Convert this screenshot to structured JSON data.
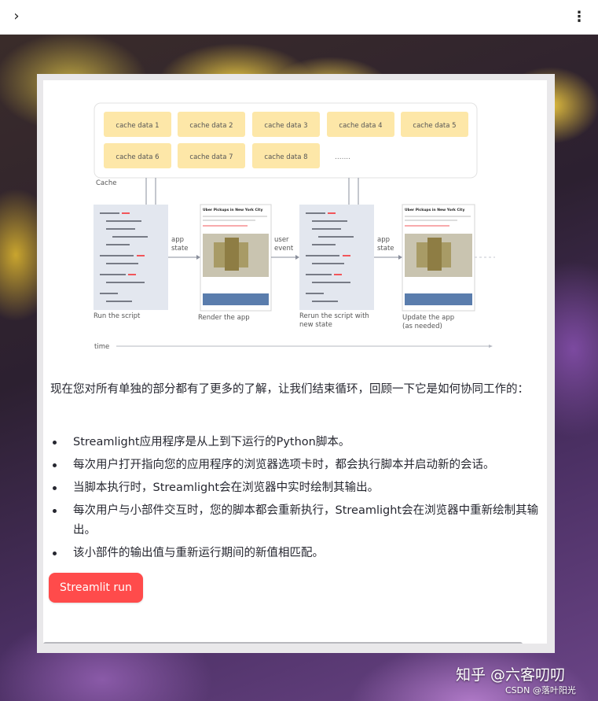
{
  "toolbar": {
    "expand_icon": "chevron-right-icon",
    "menu_icon": "kebab-menu-icon"
  },
  "diagram": {
    "cache_title": "Cache",
    "cache_items": [
      "cache data 1",
      "cache data 2",
      "cache data 3",
      "cache data 4",
      "cache data 5",
      "cache data 6",
      "cache data 7",
      "cache data 8",
      "......."
    ],
    "stages": {
      "run_script": "Run the script",
      "render_app": "Render the app",
      "rerun_line1": "Rerun the script with",
      "rerun_line2": "new state",
      "update_line1": "Update the app",
      "update_line2": "(as needed)"
    },
    "arrows": {
      "app_state_1_line1": "app",
      "app_state_1_line2": "state",
      "user_event_line1": "user",
      "user_event_line2": "event",
      "app_state_2_line1": "app",
      "app_state_2_line2": "state"
    },
    "thumb_title": "Uber Pickups in New York City",
    "time_label": "time",
    "colors": {
      "cache_box": "#fde7a8",
      "script_bg": "#e3e7ef",
      "red_line": "#f2555a"
    }
  },
  "content": {
    "paragraph": "现在您对所有单独的部分都有了更多的了解，让我们结束循环，回顾一下它是如何协同工作的：",
    "bullets": [
      "Streamlight应用程序是从上到下运行的Python脚本。",
      "每次用户打开指向您的应用程序的浏览器选项卡时，都会执行脚本并启动新的会话。",
      "当脚本执行时，Streamlight会在浏览器中实时绘制其输出。",
      "每次用户与小部件交互时，您的脚本都会重新执行，Streamlight会在浏览器中重新绘制其输出。",
      "该小部件的输出值与重新运行期间的新值相匹配。"
    ],
    "button_label": "Streamlit run",
    "button_color": "#ff4b4b"
  },
  "overlay": {
    "watermark": "知乎 @六客叨叨",
    "credit": "CSDN @落叶阳光"
  }
}
